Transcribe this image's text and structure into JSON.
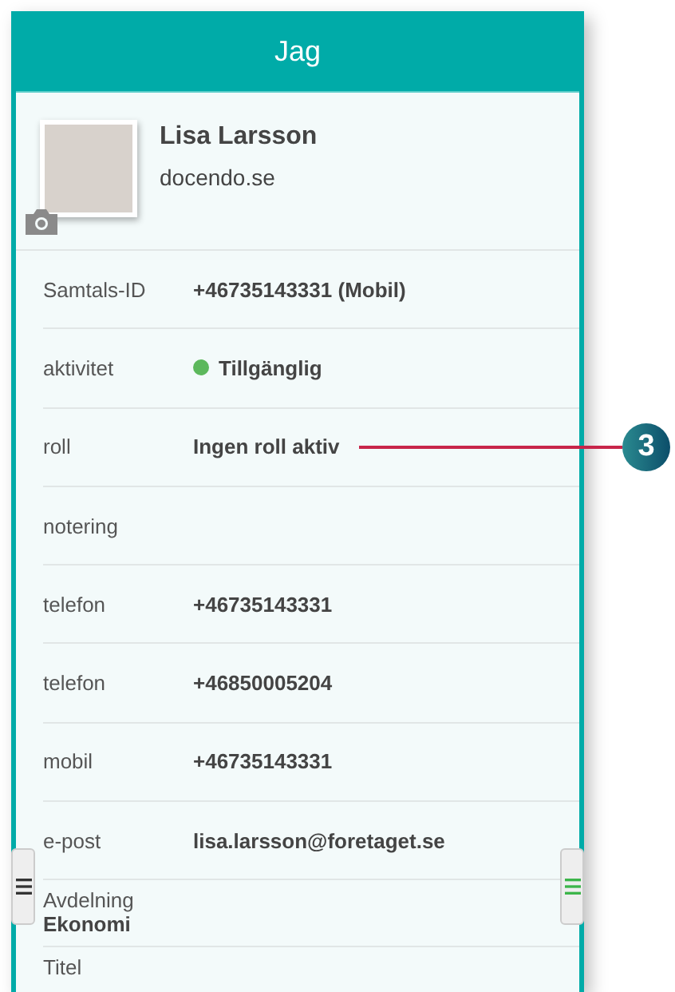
{
  "header": {
    "title": "Jag"
  },
  "profile": {
    "name": "Lisa Larsson",
    "organization": "docendo.se"
  },
  "rows": [
    {
      "kind": "field",
      "label": "Samtals-ID",
      "value": "+46735143331 (Mobil)"
    },
    {
      "kind": "status",
      "label": "aktivitet",
      "value": "Tillgänglig",
      "color": "#5cb85c"
    },
    {
      "kind": "field",
      "label": "roll",
      "value": "Ingen roll aktiv",
      "callout": "3"
    },
    {
      "kind": "field",
      "label": "notering"
    },
    {
      "kind": "field",
      "label": "telefon",
      "value": "+46735143331"
    },
    {
      "kind": "field",
      "label": "telefon",
      "value": "+46850005204"
    },
    {
      "kind": "field",
      "label": "mobil",
      "value": "+46735143331"
    },
    {
      "kind": "field",
      "label": "e-post",
      "value": "lisa.larsson@foretaget.se"
    },
    {
      "kind": "stacked",
      "label": "Avdelning",
      "value": "Ekonomi"
    },
    {
      "kind": "stacked",
      "label": "Titel"
    }
  ]
}
